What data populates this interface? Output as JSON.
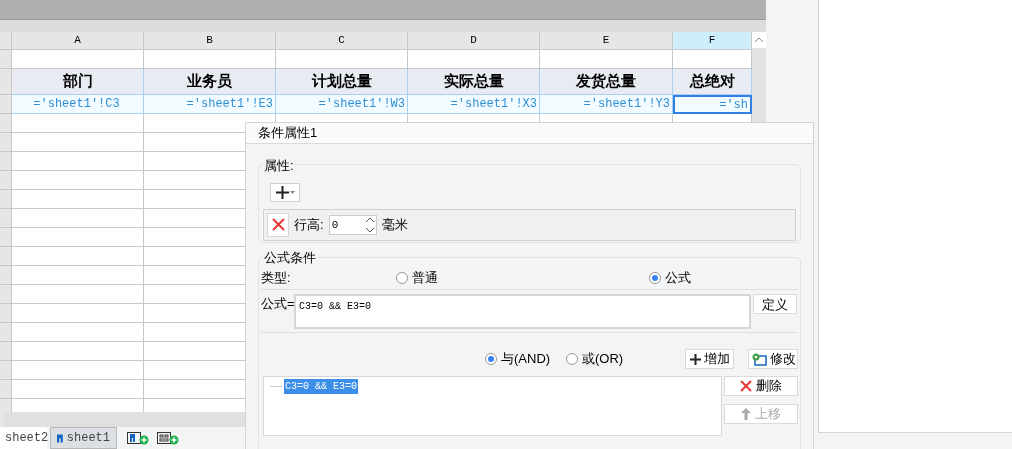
{
  "columns": [
    {
      "label": "A",
      "selected": false
    },
    {
      "label": "B",
      "selected": false
    },
    {
      "label": "C",
      "selected": false
    },
    {
      "label": "D",
      "selected": false
    },
    {
      "label": "E",
      "selected": false
    },
    {
      "label": "F",
      "selected": true
    }
  ],
  "header_row": [
    "部门",
    "业务员",
    "计划总量",
    "实际总量",
    "发货总量",
    "总绝对"
  ],
  "formula_row": [
    {
      "text": "='sheet1'!C3",
      "selected": false
    },
    {
      "text": "='sheet1'!E3",
      "selected": false
    },
    {
      "text": "='sheet1'!W3",
      "selected": false
    },
    {
      "text": "='sheet1'!X3",
      "selected": false
    },
    {
      "text": "='sheet1'!Y3",
      "selected": false
    },
    {
      "text": "='sh",
      "selected": true
    }
  ],
  "sheet_tabs": [
    {
      "label": "sheet2",
      "selected": false
    },
    {
      "label": "sheet1",
      "selected": true
    }
  ],
  "dialog": {
    "title": "条件属性1",
    "property_group": {
      "title": "属性:",
      "row_height_label": "行高:",
      "row_height_value": "0",
      "unit": "毫米"
    },
    "formula_group": {
      "title": "公式条件",
      "type_label": "类型:",
      "types": [
        {
          "label": "普通",
          "selected": false
        },
        {
          "label": "公式",
          "selected": true
        }
      ],
      "formula_label": "公式=",
      "formula": "C3=0 && E3=0",
      "define_button": "定义",
      "logic": [
        {
          "label": "与(AND)",
          "selected": true
        },
        {
          "label": "或(OR)",
          "selected": false
        }
      ],
      "add_button": "增加",
      "edit_button": "修改",
      "conditions": [
        {
          "text": "C3=0 && E3=0",
          "selected": true
        }
      ],
      "delete_button": {
        "label": "删除",
        "disabled": false
      },
      "move_up_button": {
        "label": "上移",
        "disabled": true
      }
    }
  }
}
